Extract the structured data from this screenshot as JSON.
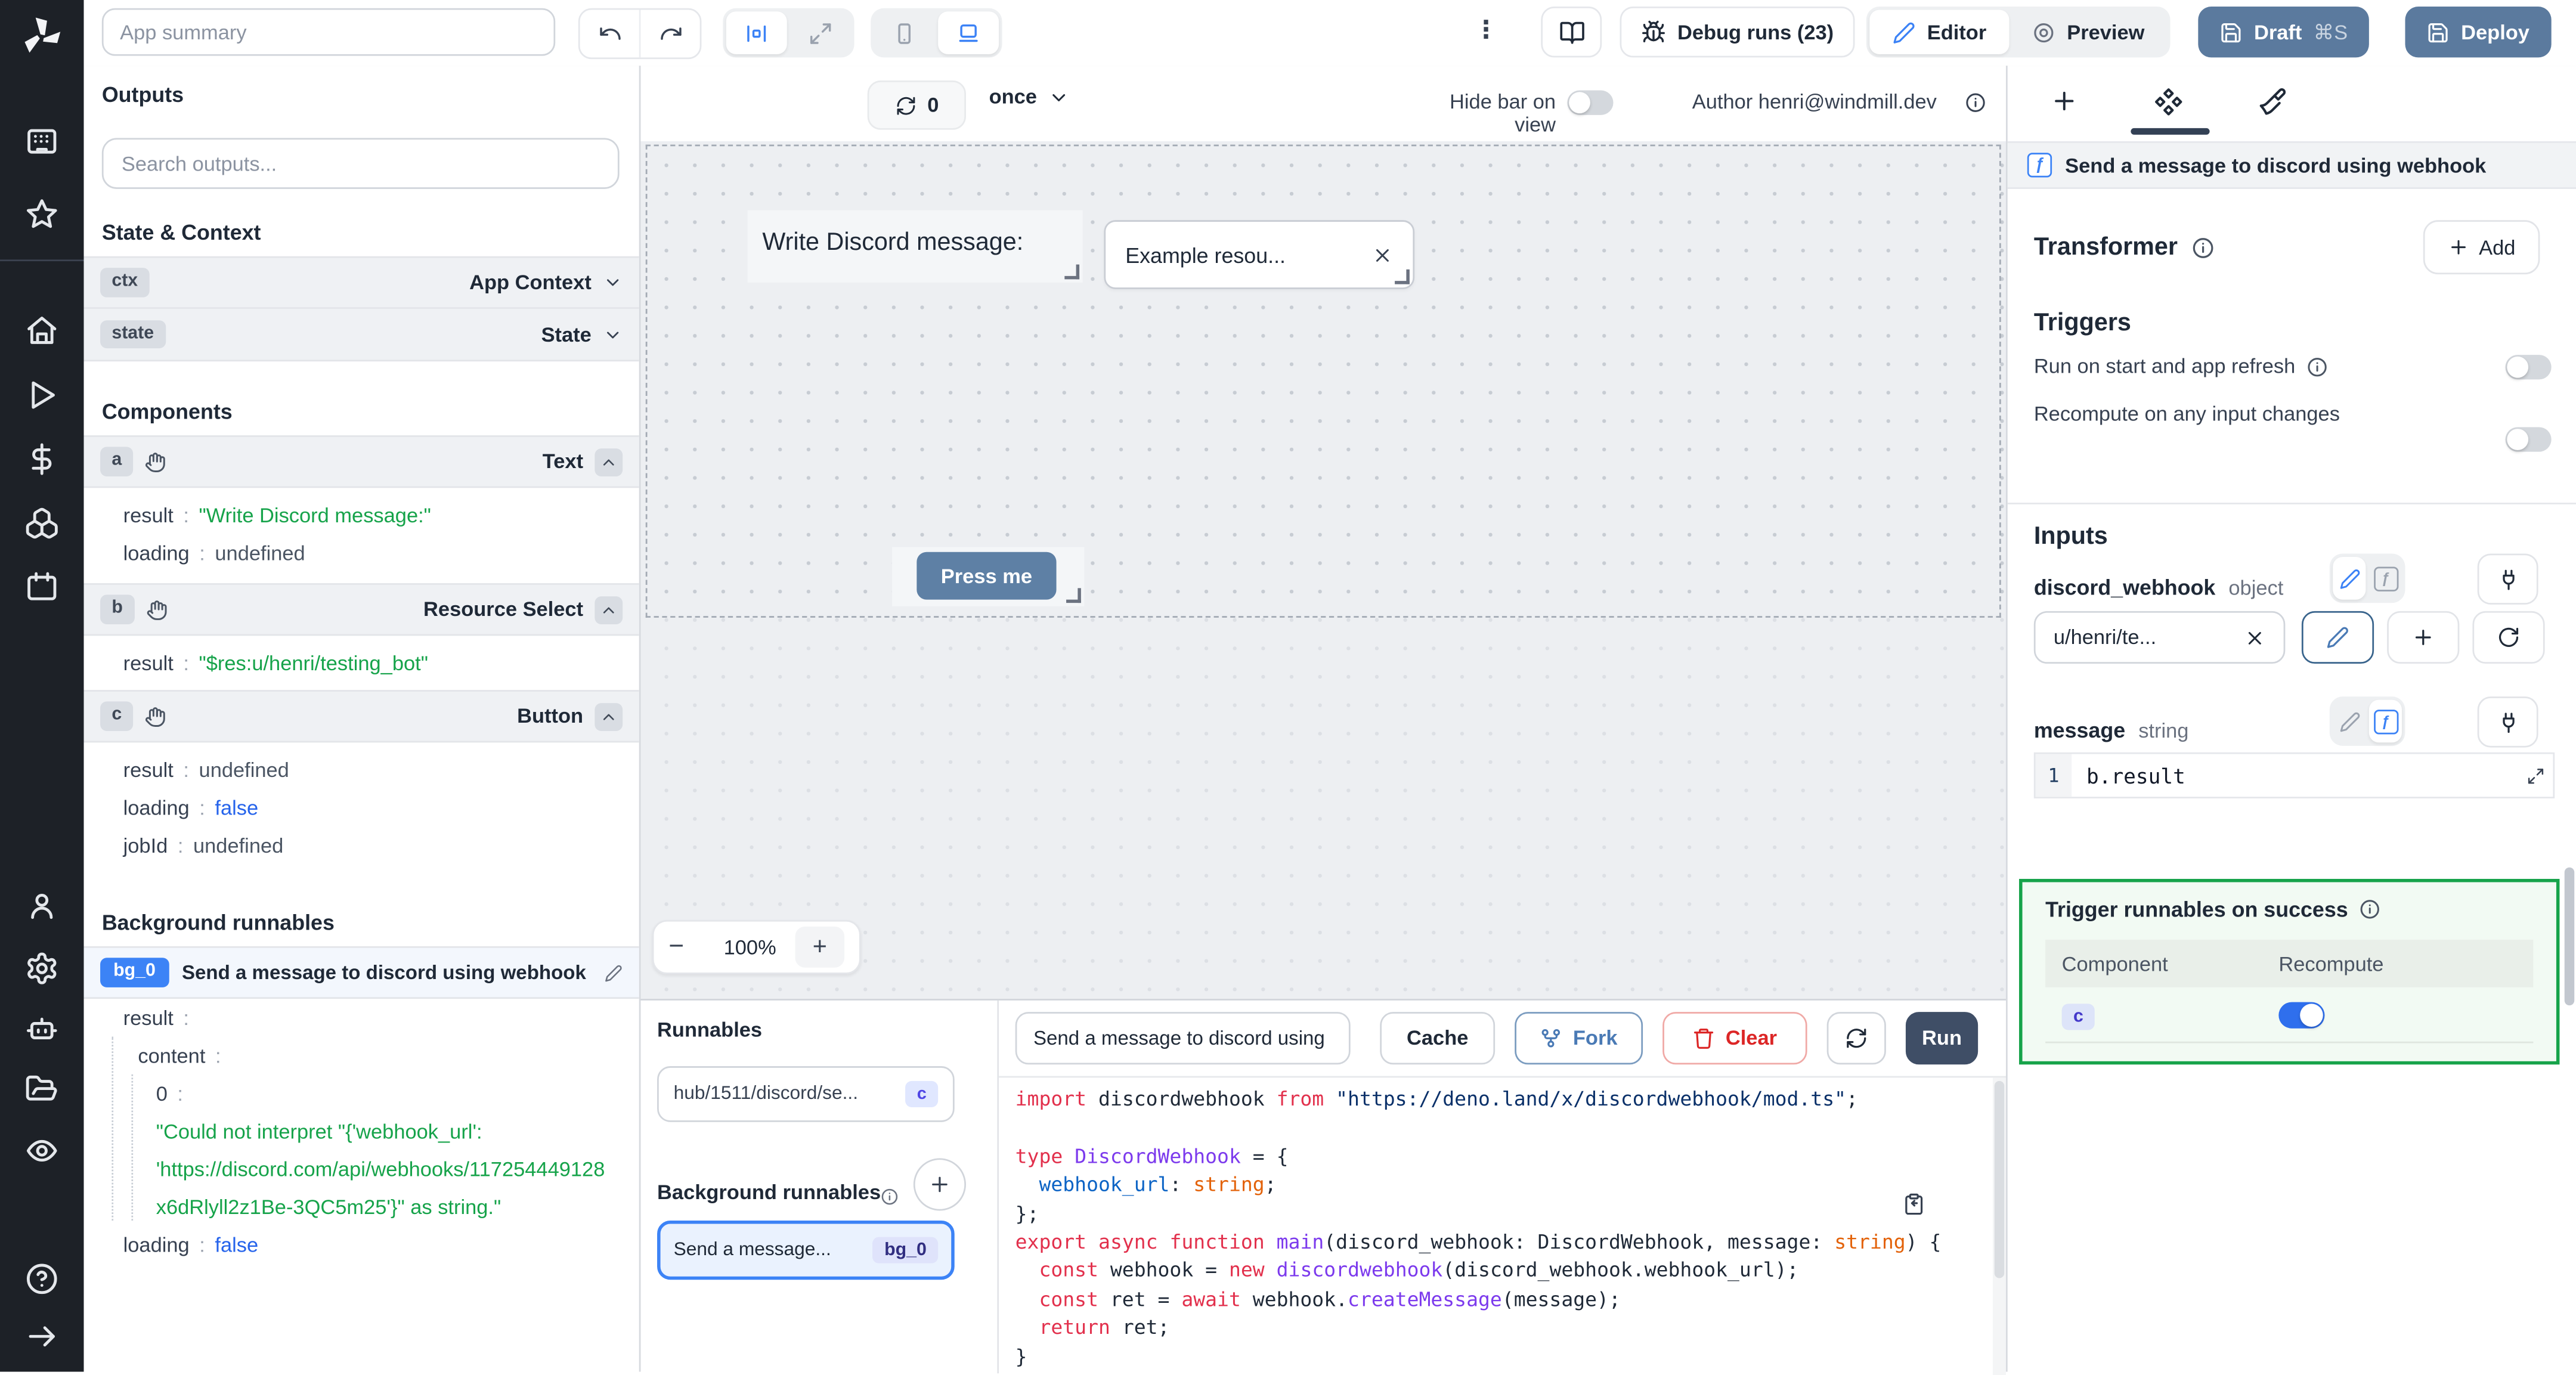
{
  "icons": {
    "kebab": "⋮",
    "minus": "−",
    "plus": "+",
    "function_glyph": "ƒ"
  },
  "colors": {
    "accent_blue": "#3b82f6",
    "slate_button": "#5b7a9e",
    "run_button": "#3f4e66",
    "success_green": "#16a34a",
    "toggle_on": "#2f6fed",
    "value_green": "#16a34a",
    "value_blue": "#2563eb"
  },
  "topbar": {
    "app_summary_placeholder": "App summary",
    "debug_runs_label": "Debug runs (23)",
    "editor_label": "Editor",
    "preview_label": "Preview",
    "draft_label": "Draft",
    "draft_shortcut": "⌘S",
    "deploy_label": "Deploy"
  },
  "outputs_panel": {
    "title": "Outputs",
    "search_placeholder": "Search outputs...",
    "state_context_heading": "State & Context",
    "ctx": {
      "key": "ctx",
      "label": "App Context"
    },
    "state": {
      "key": "state",
      "label": "State"
    },
    "components_heading": "Components",
    "comp_a": {
      "key": "a",
      "type": "Text",
      "result_key": "result",
      "result": "\"Write Discord message:\"",
      "loading_key": "loading",
      "loading": "undefined"
    },
    "comp_b": {
      "key": "b",
      "type": "Resource Select",
      "result_key": "result",
      "result": "\"$res:u/henri/testing_bot\""
    },
    "comp_c": {
      "key": "c",
      "type": "Button",
      "result_key": "result",
      "result": "undefined",
      "loading_key": "loading",
      "loading": "false",
      "jobid_key": "jobId",
      "jobid": "undefined"
    },
    "bg_heading": "Background runnables",
    "bg0": {
      "badge": "bg_0",
      "title": "Send a message to discord using webhook",
      "result_key": "result",
      "content_key": "content",
      "zero_key": "0",
      "error_line1": "\"Could not interpret \"{'webhook_url':",
      "error_line2": "'https://discord.com/api/webhooks/117254449128",
      "error_line3": "x6dRlyll2z1Be-3QC5m25'}\" as string.\"",
      "loading_key": "loading",
      "loading": "false"
    }
  },
  "canvas": {
    "refresh_count": "0",
    "schedule": "once",
    "hide_bar_label": "Hide bar on view",
    "author_label": "Author henri@windmill.dev",
    "text_component": "Write Discord message:",
    "select_value": "Example resou...",
    "button_label": "Press me",
    "zoom_level": "100%"
  },
  "runnables_panel": {
    "title": "Runnables",
    "item_path": "hub/1511/discord/se...",
    "item_badge": "c",
    "bg_heading": "Background runnables",
    "bg_item_label": "Send a message...",
    "bg_item_badge": "bg_0"
  },
  "code_panel": {
    "name_value": "Send a message to discord using",
    "cache_label": "Cache",
    "fork_label": "Fork",
    "clear_label": "Clear",
    "run_label": "Run",
    "lines": [
      [
        [
          "kw",
          "import"
        ],
        [
          "pl",
          " discordwebhook "
        ],
        [
          "kw",
          "from"
        ],
        [
          "str",
          " \"https://deno.land/x/discordwebhook/mod.ts\""
        ],
        [
          "pl",
          ";"
        ]
      ],
      [],
      [
        [
          "kw",
          "type"
        ],
        [
          "ty",
          " DiscordWebhook"
        ],
        [
          "pl",
          " = {"
        ]
      ],
      [
        [
          "prop",
          "  webhook_url"
        ],
        [
          "pl",
          ": "
        ],
        [
          "tystr",
          "string"
        ],
        [
          "pl",
          ";"
        ]
      ],
      [
        [
          "pl",
          "};"
        ]
      ],
      [
        [
          "kw",
          "export"
        ],
        [
          "pl",
          " "
        ],
        [
          "kw",
          "async"
        ],
        [
          "pl",
          " "
        ],
        [
          "kw",
          "function"
        ],
        [
          "fn",
          " main"
        ],
        [
          "pl",
          "(discord_webhook: DiscordWebhook, message: "
        ],
        [
          "tystr",
          "string"
        ],
        [
          "pl",
          ") {"
        ]
      ],
      [
        [
          "pl",
          "  "
        ],
        [
          "kw",
          "const"
        ],
        [
          "pl",
          " webhook = "
        ],
        [
          "kw",
          "new"
        ],
        [
          "fn",
          " discordwebhook"
        ],
        [
          "pl",
          "(discord_webhook.webhook_url);"
        ]
      ],
      [
        [
          "pl",
          "  "
        ],
        [
          "kw",
          "const"
        ],
        [
          "pl",
          " ret = "
        ],
        [
          "kw",
          "await"
        ],
        [
          "pl",
          " webhook."
        ],
        [
          "fn",
          "createMessage"
        ],
        [
          "pl",
          "(message);"
        ]
      ],
      [
        [
          "pl",
          "  "
        ],
        [
          "kw",
          "return"
        ],
        [
          "pl",
          " ret;"
        ]
      ],
      [
        [
          "pl",
          "}"
        ]
      ]
    ]
  },
  "right_panel": {
    "header_title": "Send a message to discord using webhook",
    "transformer_heading": "Transformer",
    "add_label": "Add",
    "triggers_heading": "Triggers",
    "trigger1": "Run on start and app refresh",
    "trigger2": "Recompute on any input changes",
    "inputs_heading": "Inputs",
    "input1": {
      "name": "discord_webhook",
      "type": "object",
      "value": "u/henri/te..."
    },
    "input2": {
      "name": "message",
      "type": "string",
      "line_number": "1",
      "expr": "b.result"
    },
    "success_box": {
      "title": "Trigger runnables on success",
      "col_component": "Component",
      "col_recompute": "Recompute",
      "row_badge": "c"
    }
  }
}
